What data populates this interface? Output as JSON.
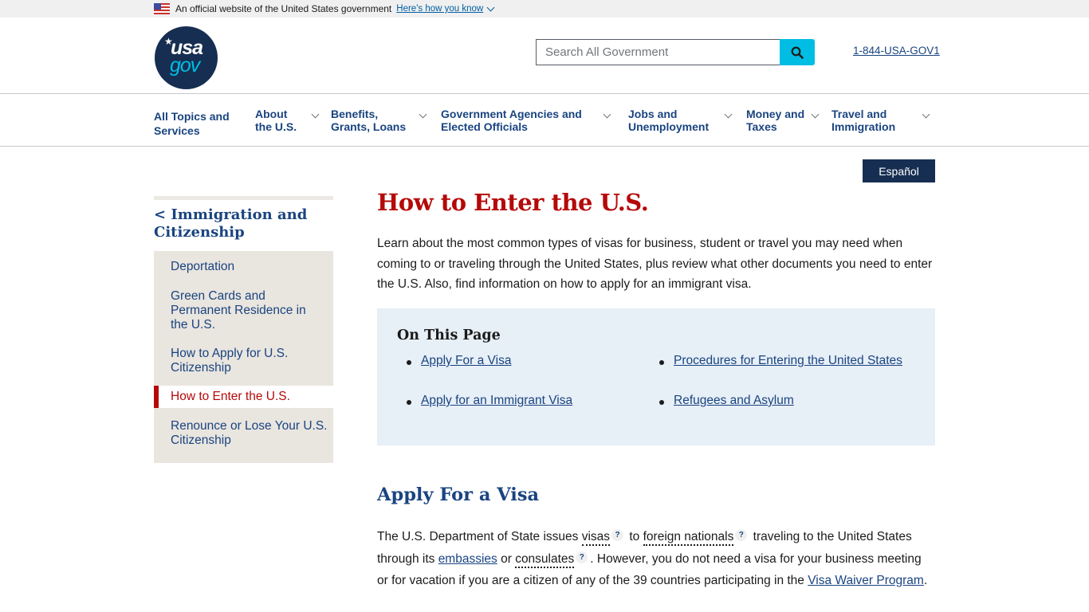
{
  "gov_banner": {
    "text": "An official website of the United States government",
    "link": "Here's how you know",
    "flag_icon": "us-flag-icon"
  },
  "header": {
    "logo": {
      "line1": "usa",
      "line2": "gov"
    },
    "search": {
      "placeholder": "Search All Government",
      "value": "",
      "button_icon": "search-icon"
    },
    "phone": "1-844-USA-GOV1"
  },
  "nav": {
    "items": [
      {
        "label": "All Topics and Services",
        "has_menu": false
      },
      {
        "label": "About the U.S.",
        "has_menu": true
      },
      {
        "label": "Benefits, Grants, Loans",
        "has_menu": true
      },
      {
        "label": "Government Agencies and Elected Officials",
        "has_menu": true
      },
      {
        "label": "Jobs and Unemployment",
        "has_menu": true
      },
      {
        "label": "Money and Taxes",
        "has_menu": true
      },
      {
        "label": "Travel and Immigration",
        "has_menu": true
      }
    ]
  },
  "language_toggle": "Español",
  "sidebar": {
    "parent": "< Immigration and Citizenship",
    "items": [
      {
        "label": "Deportation",
        "active": false
      },
      {
        "label": "Green Cards and Permanent Residence in the U.S.",
        "active": false
      },
      {
        "label": "How to Apply for U.S. Citizenship",
        "active": false
      },
      {
        "label": "How to Enter the U.S.",
        "active": true
      },
      {
        "label": "Renounce or Lose Your U.S. Citizenship",
        "active": false
      }
    ]
  },
  "main": {
    "title": "How to Enter the U.S.",
    "intro": "Learn about the most common types of visas for business, student or travel you may need when coming to or traveling through the United States, plus review what other documents you need to enter the U.S. Also, find information on how to apply for an immigrant visa.",
    "on_this_page": {
      "title": "On This Page",
      "links": [
        "Apply For a Visa",
        "Procedures for Entering the United States",
        "Apply for an Immigrant Visa",
        "Refugees and Asylum"
      ]
    },
    "section": {
      "title": "Apply For a Visa",
      "p_parts": {
        "t1": "The U.S. Department of State issues ",
        "g1": "visas",
        "t2": " to ",
        "g2": "foreign nationals",
        "t3": " traveling to the United States through its ",
        "l1": "embassies",
        "t4": " or ",
        "g3": "consulates",
        "t5": ". However, you do not need a visa for your business meeting or for vacation if you are a citizen of any of the 39 countries participating in the ",
        "l2": "Visa Waiver Program",
        "t6": "."
      },
      "glossary_marker": "?"
    }
  },
  "colors": {
    "primary_blue": "#1a4480",
    "dark_navy": "#162e51",
    "title_red": "#b50909",
    "search_cyan": "#00bde3",
    "sidebar_bg": "#e9e5df",
    "otp_bg": "#e7eff7"
  }
}
